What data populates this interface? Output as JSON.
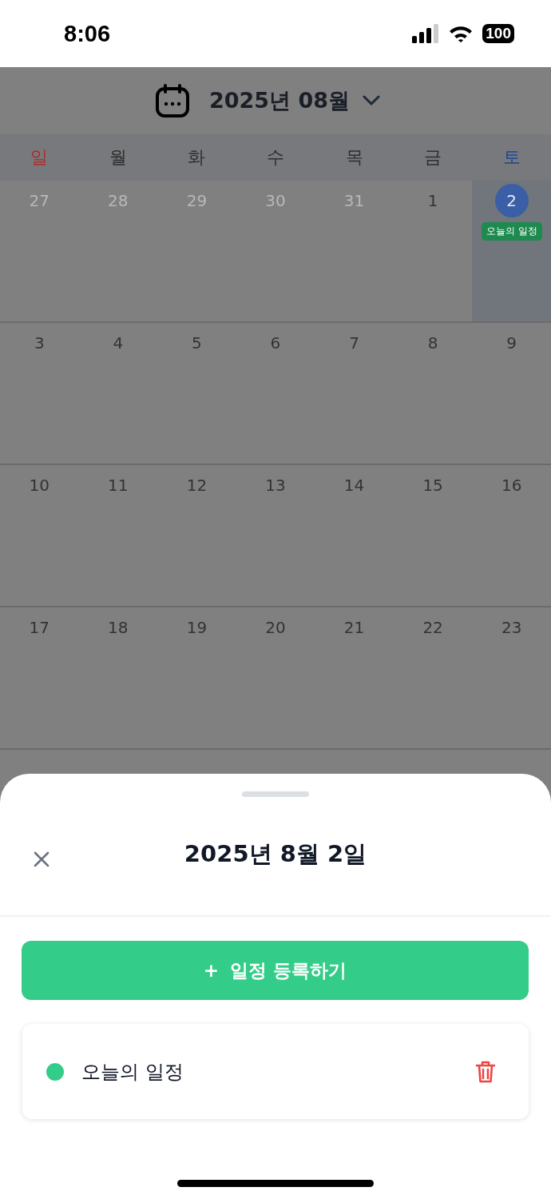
{
  "status_bar": {
    "time": "8:06",
    "battery": "100"
  },
  "calendar": {
    "month_title": "2025년 08월",
    "weekdays": [
      {
        "label": "일",
        "color": "#b02a2a"
      },
      {
        "label": "월",
        "color": "#2e2e2e"
      },
      {
        "label": "화",
        "color": "#2e2e2e"
      },
      {
        "label": "수",
        "color": "#2e2e2e"
      },
      {
        "label": "목",
        "color": "#2e2e2e"
      },
      {
        "label": "금",
        "color": "#2e2e2e"
      },
      {
        "label": "토",
        "color": "#1f4596"
      }
    ],
    "weeks": [
      [
        {
          "day": "27",
          "other_month": true,
          "selected": false
        },
        {
          "day": "28",
          "other_month": true,
          "selected": false
        },
        {
          "day": "29",
          "other_month": true,
          "selected": false
        },
        {
          "day": "30",
          "other_month": true,
          "selected": false
        },
        {
          "day": "31",
          "other_month": true,
          "selected": false
        },
        {
          "day": "1",
          "other_month": false,
          "selected": false
        },
        {
          "day": "2",
          "other_month": false,
          "selected": true,
          "events": [
            {
              "title": "오늘의 일정",
              "color": "#1e8a4f"
            }
          ]
        }
      ],
      [
        {
          "day": "3",
          "other_month": false,
          "selected": false
        },
        {
          "day": "4",
          "other_month": false,
          "selected": false
        },
        {
          "day": "5",
          "other_month": false,
          "selected": false
        },
        {
          "day": "6",
          "other_month": false,
          "selected": false
        },
        {
          "day": "7",
          "other_month": false,
          "selected": false
        },
        {
          "day": "8",
          "other_month": false,
          "selected": false
        },
        {
          "day": "9",
          "other_month": false,
          "selected": false
        }
      ],
      [
        {
          "day": "10",
          "other_month": false,
          "selected": false
        },
        {
          "day": "11",
          "other_month": false,
          "selected": false
        },
        {
          "day": "12",
          "other_month": false,
          "selected": false
        },
        {
          "day": "13",
          "other_month": false,
          "selected": false
        },
        {
          "day": "14",
          "other_month": false,
          "selected": false
        },
        {
          "day": "15",
          "other_month": false,
          "selected": false
        },
        {
          "day": "16",
          "other_month": false,
          "selected": false
        }
      ],
      [
        {
          "day": "17",
          "other_month": false,
          "selected": false
        },
        {
          "day": "18",
          "other_month": false,
          "selected": false
        },
        {
          "day": "19",
          "other_month": false,
          "selected": false
        },
        {
          "day": "20",
          "other_month": false,
          "selected": false
        },
        {
          "day": "21",
          "other_month": false,
          "selected": false
        },
        {
          "day": "22",
          "other_month": false,
          "selected": false
        },
        {
          "day": "23",
          "other_month": false,
          "selected": false
        }
      ]
    ]
  },
  "sheet": {
    "title": "2025년 8월 2일",
    "add_button": {
      "icon": "+",
      "label": "일정 등록하기"
    },
    "events": [
      {
        "title": "오늘의 일정",
        "color": "#33cc88"
      }
    ]
  }
}
